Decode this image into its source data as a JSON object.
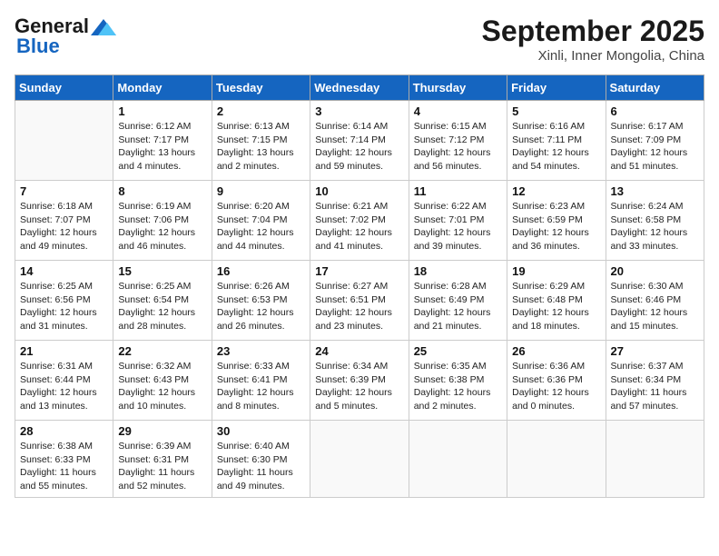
{
  "header": {
    "logo_line1": "General",
    "logo_line2": "Blue",
    "month": "September 2025",
    "location": "Xinli, Inner Mongolia, China"
  },
  "weekdays": [
    "Sunday",
    "Monday",
    "Tuesday",
    "Wednesday",
    "Thursday",
    "Friday",
    "Saturday"
  ],
  "weeks": [
    [
      {
        "day": "",
        "info": ""
      },
      {
        "day": "1",
        "info": "Sunrise: 6:12 AM\nSunset: 7:17 PM\nDaylight: 13 hours\nand 4 minutes."
      },
      {
        "day": "2",
        "info": "Sunrise: 6:13 AM\nSunset: 7:15 PM\nDaylight: 13 hours\nand 2 minutes."
      },
      {
        "day": "3",
        "info": "Sunrise: 6:14 AM\nSunset: 7:14 PM\nDaylight: 12 hours\nand 59 minutes."
      },
      {
        "day": "4",
        "info": "Sunrise: 6:15 AM\nSunset: 7:12 PM\nDaylight: 12 hours\nand 56 minutes."
      },
      {
        "day": "5",
        "info": "Sunrise: 6:16 AM\nSunset: 7:11 PM\nDaylight: 12 hours\nand 54 minutes."
      },
      {
        "day": "6",
        "info": "Sunrise: 6:17 AM\nSunset: 7:09 PM\nDaylight: 12 hours\nand 51 minutes."
      }
    ],
    [
      {
        "day": "7",
        "info": "Sunrise: 6:18 AM\nSunset: 7:07 PM\nDaylight: 12 hours\nand 49 minutes."
      },
      {
        "day": "8",
        "info": "Sunrise: 6:19 AM\nSunset: 7:06 PM\nDaylight: 12 hours\nand 46 minutes."
      },
      {
        "day": "9",
        "info": "Sunrise: 6:20 AM\nSunset: 7:04 PM\nDaylight: 12 hours\nand 44 minutes."
      },
      {
        "day": "10",
        "info": "Sunrise: 6:21 AM\nSunset: 7:02 PM\nDaylight: 12 hours\nand 41 minutes."
      },
      {
        "day": "11",
        "info": "Sunrise: 6:22 AM\nSunset: 7:01 PM\nDaylight: 12 hours\nand 39 minutes."
      },
      {
        "day": "12",
        "info": "Sunrise: 6:23 AM\nSunset: 6:59 PM\nDaylight: 12 hours\nand 36 minutes."
      },
      {
        "day": "13",
        "info": "Sunrise: 6:24 AM\nSunset: 6:58 PM\nDaylight: 12 hours\nand 33 minutes."
      }
    ],
    [
      {
        "day": "14",
        "info": "Sunrise: 6:25 AM\nSunset: 6:56 PM\nDaylight: 12 hours\nand 31 minutes."
      },
      {
        "day": "15",
        "info": "Sunrise: 6:25 AM\nSunset: 6:54 PM\nDaylight: 12 hours\nand 28 minutes."
      },
      {
        "day": "16",
        "info": "Sunrise: 6:26 AM\nSunset: 6:53 PM\nDaylight: 12 hours\nand 26 minutes."
      },
      {
        "day": "17",
        "info": "Sunrise: 6:27 AM\nSunset: 6:51 PM\nDaylight: 12 hours\nand 23 minutes."
      },
      {
        "day": "18",
        "info": "Sunrise: 6:28 AM\nSunset: 6:49 PM\nDaylight: 12 hours\nand 21 minutes."
      },
      {
        "day": "19",
        "info": "Sunrise: 6:29 AM\nSunset: 6:48 PM\nDaylight: 12 hours\nand 18 minutes."
      },
      {
        "day": "20",
        "info": "Sunrise: 6:30 AM\nSunset: 6:46 PM\nDaylight: 12 hours\nand 15 minutes."
      }
    ],
    [
      {
        "day": "21",
        "info": "Sunrise: 6:31 AM\nSunset: 6:44 PM\nDaylight: 12 hours\nand 13 minutes."
      },
      {
        "day": "22",
        "info": "Sunrise: 6:32 AM\nSunset: 6:43 PM\nDaylight: 12 hours\nand 10 minutes."
      },
      {
        "day": "23",
        "info": "Sunrise: 6:33 AM\nSunset: 6:41 PM\nDaylight: 12 hours\nand 8 minutes."
      },
      {
        "day": "24",
        "info": "Sunrise: 6:34 AM\nSunset: 6:39 PM\nDaylight: 12 hours\nand 5 minutes."
      },
      {
        "day": "25",
        "info": "Sunrise: 6:35 AM\nSunset: 6:38 PM\nDaylight: 12 hours\nand 2 minutes."
      },
      {
        "day": "26",
        "info": "Sunrise: 6:36 AM\nSunset: 6:36 PM\nDaylight: 12 hours\nand 0 minutes."
      },
      {
        "day": "27",
        "info": "Sunrise: 6:37 AM\nSunset: 6:34 PM\nDaylight: 11 hours\nand 57 minutes."
      }
    ],
    [
      {
        "day": "28",
        "info": "Sunrise: 6:38 AM\nSunset: 6:33 PM\nDaylight: 11 hours\nand 55 minutes."
      },
      {
        "day": "29",
        "info": "Sunrise: 6:39 AM\nSunset: 6:31 PM\nDaylight: 11 hours\nand 52 minutes."
      },
      {
        "day": "30",
        "info": "Sunrise: 6:40 AM\nSunset: 6:30 PM\nDaylight: 11 hours\nand 49 minutes."
      },
      {
        "day": "",
        "info": ""
      },
      {
        "day": "",
        "info": ""
      },
      {
        "day": "",
        "info": ""
      },
      {
        "day": "",
        "info": ""
      }
    ]
  ]
}
